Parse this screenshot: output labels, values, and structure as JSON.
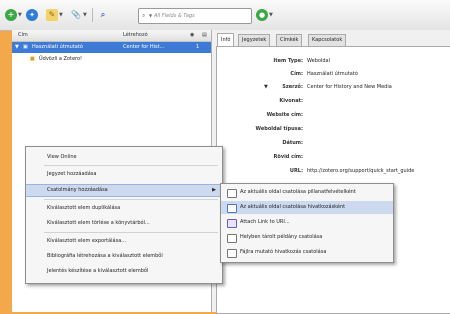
{
  "toolbar": {
    "search_placeholder": "All Fields & Tags"
  },
  "columns": {
    "title": "Cím",
    "creator": "Létrehozó"
  },
  "items": [
    {
      "title": "Használati útmutató",
      "creator": "Center for Hist...",
      "count": "1"
    },
    {
      "title": "Üdvözli a Zotero!",
      "creator": "",
      "count": ""
    }
  ],
  "tabs": [
    "Infó",
    "Jegyzetek",
    "Címkék",
    "Kapcsolatok"
  ],
  "info_fields": [
    {
      "label": "Item Type:",
      "value": "Weboldal"
    },
    {
      "label": "Cím:",
      "value": "Használati útmutató"
    },
    {
      "label": "Szerző:",
      "value": "Center for History and New Media"
    },
    {
      "label": "Kivonat:",
      "value": ""
    },
    {
      "label": "Website cím:",
      "value": ""
    },
    {
      "label": "Weboldal típusa:",
      "value": ""
    },
    {
      "label": "Dátum:",
      "value": ""
    },
    {
      "label": "Rövid cím:",
      "value": ""
    },
    {
      "label": "URL:",
      "value": "http://zotero.org/support/quick_start_guide"
    }
  ],
  "context_menu": {
    "items": [
      "View Online",
      "Jegyzet hozzáadása",
      "Csatolmány hozzáadása",
      "Kiválasztott elem duplikálása",
      "Kiválasztott elem törlése a könyvtárból...",
      "Kiválasztott elem exportálása...",
      "Bibliográfia létrehozása a kiválasztott elemből",
      "Jelentés készítése a kiválasztott elemből"
    ]
  },
  "submenu": {
    "items": [
      "Az aktuális oldal csatolása pillanatfelvételként",
      "Az aktuális oldal csatolása hivatkozásként",
      "Attach Link to URI...",
      "Helyben tárolt példány csatolása",
      "Fájlra mutató hivatkozás csatolása"
    ]
  }
}
